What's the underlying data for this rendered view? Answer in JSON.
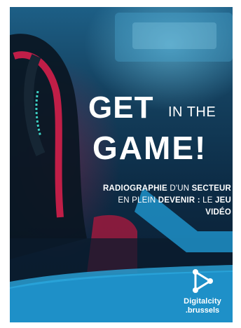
{
  "headline": {
    "get": "GET",
    "in_the": "IN THE",
    "game": "GAME!"
  },
  "subtitle": {
    "line1_bold": "RADIOGRAPHIE",
    "line1_normal_a": "D'UN",
    "line1_bold_b": "SECTEUR",
    "line2_normal_a": "EN PLEIN",
    "line2_bold_a": "DEVENIR :",
    "line2_normal_b": "LE",
    "line2_bold_b": "JEU VIDÉO"
  },
  "logo": {
    "name": "Digitalcity",
    "sub": ".brussels"
  },
  "colors": {
    "accent_blue": "#1e90c8",
    "neon_red": "#e0204e",
    "neon_cyan": "#3fd3c6",
    "background_dark": "#0b2238"
  }
}
